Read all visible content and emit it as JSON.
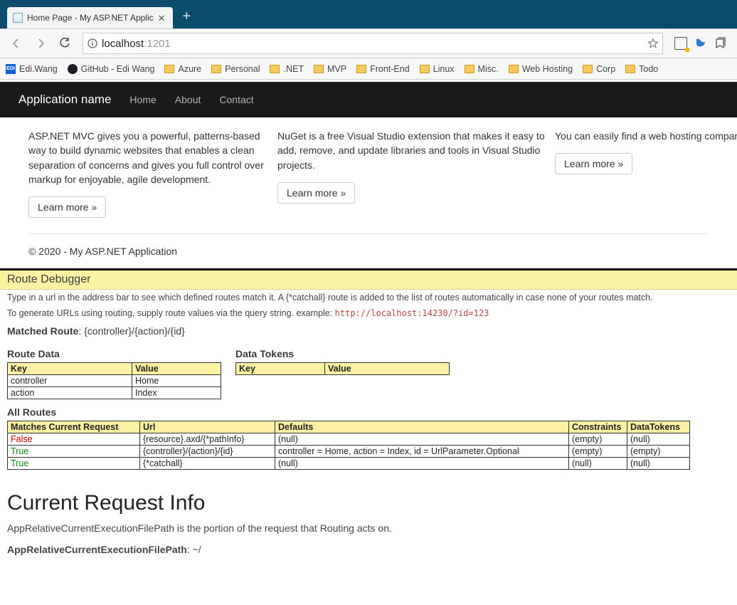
{
  "browser": {
    "tab_title": "Home Page - My ASP.NET Applic",
    "address_host": "localhost",
    "address_port": ":1201",
    "bookmarks": [
      {
        "label": "Edi.Wang",
        "icon": "edi"
      },
      {
        "label": "GitHub - Edi Wang",
        "icon": "gh"
      },
      {
        "label": "Azure",
        "icon": "folder"
      },
      {
        "label": "Personal",
        "icon": "folder"
      },
      {
        "label": ".NET",
        "icon": "folder"
      },
      {
        "label": "MVP",
        "icon": "folder"
      },
      {
        "label": "Front-End",
        "icon": "folder"
      },
      {
        "label": "Linux",
        "icon": "folder"
      },
      {
        "label": "Misc.",
        "icon": "folder"
      },
      {
        "label": "Web Hosting",
        "icon": "folder"
      },
      {
        "label": "Corp",
        "icon": "folder"
      },
      {
        "label": "Todo",
        "icon": "folder"
      }
    ]
  },
  "nav": {
    "brand": "Application name",
    "links": [
      "Home",
      "About",
      "Contact"
    ]
  },
  "cols": {
    "a_text": "ASP.NET MVC gives you a powerful, patterns-based way to build dynamic websites that enables a clean separation of concerns and gives you full control over markup for enjoyable, agile development.",
    "b_text": "NuGet is a free Visual Studio extension that makes it easy to add, remove, and update libraries and tools in Visual Studio projects.",
    "c_text": "You can easily find a web hosting company that offers the right mix of features and price for your applications.",
    "learn": "Learn more »"
  },
  "footer": "© 2020 - My ASP.NET Application",
  "rd": {
    "title": "Route Debugger",
    "intro": "Type in a url in the address bar to see which defined routes match it. A {*catchall} route is added to the list of routes automatically in case none of your routes match.",
    "gen": "To generate URLs using routing, supply route values via the query string. example: ",
    "gen_code": "http://localhost:14230/?id=123",
    "matched_label": "Matched Route",
    "matched_value": ": {controller}/{action}/{id}",
    "route_data_label": "Route Data",
    "data_tokens_label": "Data Tokens",
    "kv_headers": {
      "k": "Key",
      "v": "Value"
    },
    "route_data": [
      {
        "k": "controller",
        "v": "Home"
      },
      {
        "k": "action",
        "v": "Index"
      }
    ],
    "all_routes_label": "All Routes",
    "ar_headers": {
      "m": "Matches Current Request",
      "u": "Url",
      "d": "Defaults",
      "c": "Constraints",
      "t": "DataTokens"
    },
    "all_routes": [
      {
        "m": "False",
        "mc": "red",
        "u": "{resource}.axd/{*pathInfo}",
        "d": "(null)",
        "c": "(empty)",
        "t": "(null)"
      },
      {
        "m": "True",
        "mc": "green",
        "u": "{controller}/{action}/{id}",
        "d": "controller = Home, action = Index, id = UrlParameter.Optional",
        "c": "(empty)",
        "t": "(empty)"
      },
      {
        "m": "True",
        "mc": "green",
        "u": "{*catchall}",
        "d": "(null)",
        "c": "(null)",
        "t": "(null)"
      }
    ],
    "cri_title": "Current Request Info",
    "cri_p": "AppRelativeCurrentExecutionFilePath is the portion of the request that Routing acts on.",
    "cri_b": "AppRelativeCurrentExecutionFilePath",
    "cri_v": ": ~/"
  }
}
